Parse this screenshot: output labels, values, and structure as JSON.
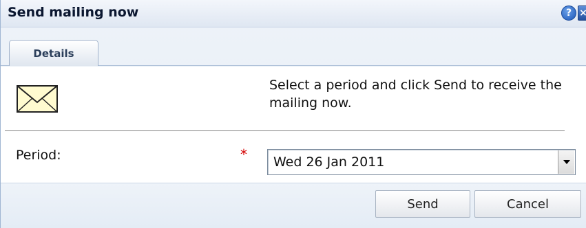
{
  "dialog": {
    "title": "Send mailing now",
    "help_icon": "?",
    "close_icon": "×"
  },
  "tabs": [
    {
      "label": "Details",
      "active": true
    }
  ],
  "details": {
    "icon": "envelope-icon",
    "info_text": "Select a period and click Send to receive the mailing now."
  },
  "period": {
    "label": "Period:",
    "required": "*",
    "selected": "Wed 26 Jan 2011"
  },
  "buttons": {
    "send": "Send",
    "cancel": "Cancel"
  },
  "colors": {
    "title": "#0b1730",
    "required": "#d40000",
    "accent": "#1b56b8"
  }
}
